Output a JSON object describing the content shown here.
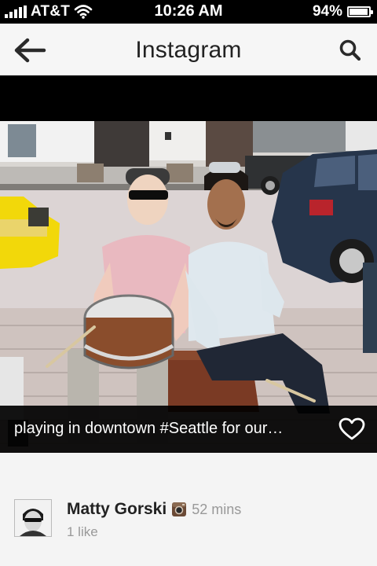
{
  "status_bar": {
    "carrier": "AT&T",
    "time": "10:26 AM",
    "battery_percent_label": "94%",
    "battery_level": 0.94
  },
  "nav": {
    "title": "Instagram",
    "back_icon": "arrow-left-icon",
    "search_icon": "search-icon"
  },
  "post": {
    "caption": "playing in downtown #Seattle for our…",
    "like_icon": "heart-outline-icon",
    "username": "Matty Gorski",
    "source_icon": "instagram-camera-icon",
    "timestamp": "52 mins",
    "likes": "1 like"
  },
  "colors": {
    "status_bar_bg": "#000000",
    "nav_bg": "#f6f6f6",
    "caption_bg": "#000000",
    "page_bg": "#f4f4f4"
  }
}
